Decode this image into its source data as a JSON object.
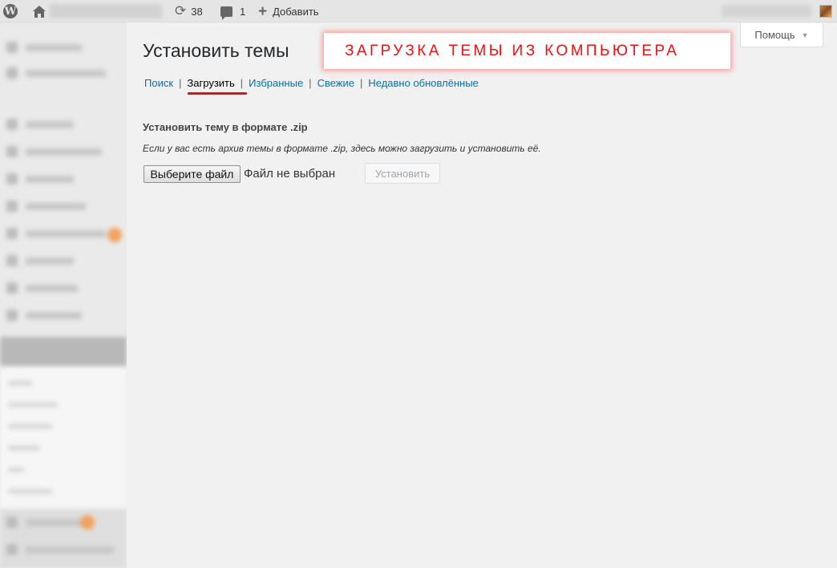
{
  "adminbar": {
    "updates_count": "38",
    "comments_count": "1",
    "add_new_label": "Добавить"
  },
  "header": {
    "page_title": "Установить темы",
    "help_label": "Помощь",
    "annotation": "ЗАГРУЗКА ТЕМЫ ИЗ КОМПЬЮТЕРА"
  },
  "subnav": {
    "items": [
      "Поиск",
      "Загрузить",
      "Избранные",
      "Свежие",
      "Недавно обновлённые"
    ],
    "current": "Загрузить",
    "separator": "|"
  },
  "upload": {
    "heading": "Установить тему в формате .zip",
    "description": "Если у вас есть архив темы в формате .zip, здесь можно загрузить и установить её.",
    "choose_file_label": "Выберите файл",
    "no_file_text": "Файл не выбран",
    "install_label": "Установить"
  },
  "colors": {
    "annotation_text": "#ee1111",
    "underline": "#e01010",
    "link": "#0073aa",
    "badge": "#f2a25e"
  },
  "icons": {
    "wp": "wordpress-icon",
    "home": "home-icon",
    "updates": "updates-icon",
    "comments": "comments-icon",
    "add": "plus-icon"
  }
}
